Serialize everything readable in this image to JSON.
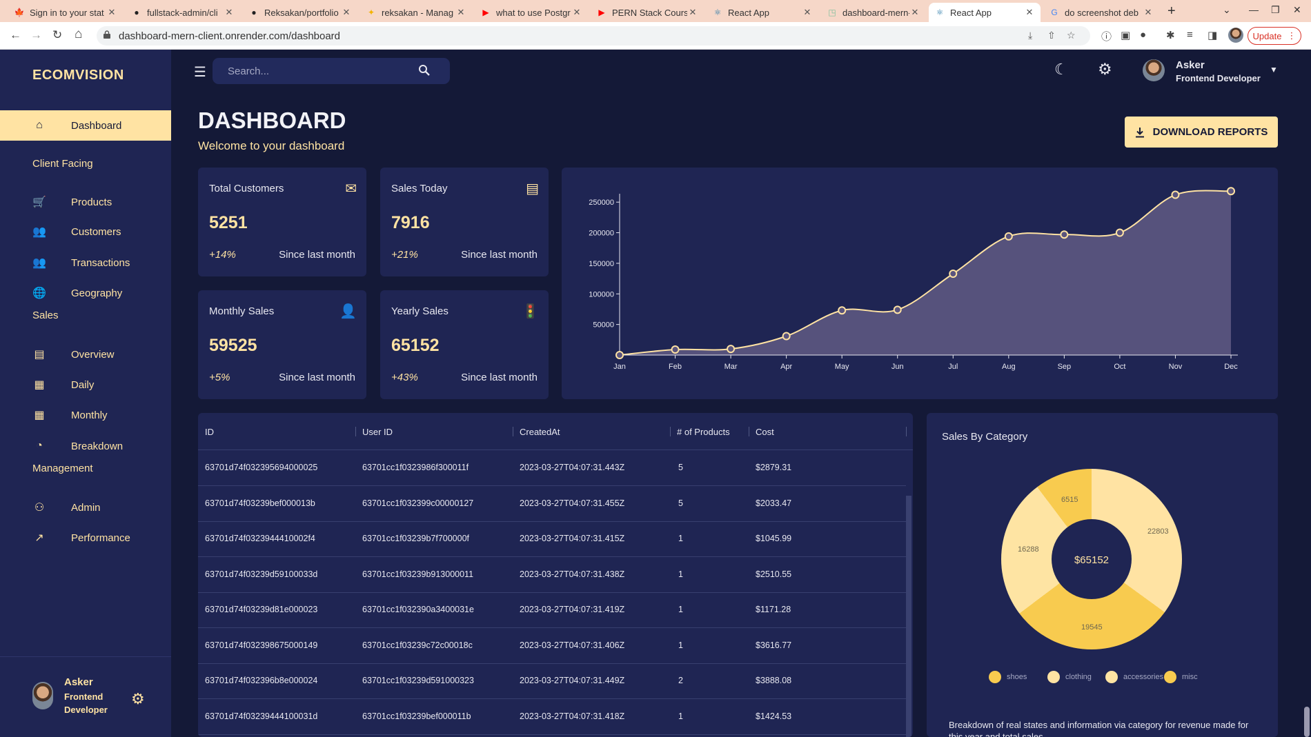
{
  "browser": {
    "tabs": [
      {
        "title": "Sign in to your stat",
        "icon": "maple-leaf-icon"
      },
      {
        "title": "fullstack-admin/cli",
        "icon": "github-icon"
      },
      {
        "title": "Reksakan/portfolio",
        "icon": "github-icon"
      },
      {
        "title": "reksakan - Manag",
        "icon": "flame-icon"
      },
      {
        "title": "what to use Postgr",
        "icon": "youtube-icon"
      },
      {
        "title": "PERN Stack Course",
        "icon": "youtube-icon"
      },
      {
        "title": "React App",
        "icon": "react-icon"
      },
      {
        "title": "dashboard-mern-c",
        "icon": "render-icon"
      },
      {
        "title": "React App",
        "icon": "react-icon",
        "active": true
      },
      {
        "title": "do screenshot deb",
        "icon": "google-icon"
      }
    ],
    "url": "dashboard-mern-client.onrender.com/dashboard",
    "update_label": "Update"
  },
  "sidebar": {
    "brand": "ECOMVISION",
    "items": [
      {
        "label": "Dashboard",
        "icon": "home-icon",
        "active": true
      },
      {
        "section": "Client Facing"
      },
      {
        "label": "Products",
        "icon": "cart-icon"
      },
      {
        "label": "Customers",
        "icon": "groups-icon"
      },
      {
        "label": "Transactions",
        "icon": "receipt-icon"
      },
      {
        "label": "Geography",
        "icon": "globe-icon"
      },
      {
        "section": "Sales"
      },
      {
        "label": "Overview",
        "icon": "point-of-sale-icon"
      },
      {
        "label": "Daily",
        "icon": "calendar-today-icon"
      },
      {
        "label": "Monthly",
        "icon": "calendar-month-icon"
      },
      {
        "label": "Breakdown",
        "icon": "pie-chart-icon"
      },
      {
        "section": "Management"
      },
      {
        "label": "Admin",
        "icon": "admin-icon"
      },
      {
        "label": "Performance",
        "icon": "trending-up-icon"
      }
    ],
    "user": {
      "name": "Asker",
      "role": "Frontend Developer"
    }
  },
  "topbar": {
    "search_placeholder": "Search...",
    "user": {
      "name": "Asker",
      "role": "Frontend Developer"
    }
  },
  "header": {
    "title": "DASHBOARD",
    "subtitle": "Welcome to your dashboard",
    "download_label": "DOWNLOAD REPORTS"
  },
  "stats": [
    {
      "title": "Total Customers",
      "value": "5251",
      "increase": "+14%",
      "description": "Since last month",
      "icon": "email-icon"
    },
    {
      "title": "Sales Today",
      "value": "7916",
      "increase": "+21%",
      "description": "Since last month",
      "icon": "point-of-sale-icon"
    },
    {
      "title": "Monthly Sales",
      "value": "59525",
      "increase": "+5%",
      "description": "Since last month",
      "icon": "person-add-icon"
    },
    {
      "title": "Yearly Sales",
      "value": "65152",
      "increase": "+43%",
      "description": "Since last month",
      "icon": "traffic-icon"
    }
  ],
  "chart_data": [
    {
      "type": "area",
      "x": [
        "Jan",
        "Feb",
        "Mar",
        "Apr",
        "May",
        "Jun",
        "Jul",
        "Aug",
        "Sep",
        "Oct",
        "Nov",
        "Dec"
      ],
      "series": [
        {
          "values": [
            0,
            9000,
            10000,
            31000,
            73000,
            74000,
            133000,
            194000,
            197000,
            200000,
            262000,
            268000
          ]
        }
      ],
      "yticks": [
        50000,
        100000,
        150000,
        200000,
        250000
      ],
      "ylim": [
        0,
        275000
      ],
      "colors": {
        "line": "#ffe3a3",
        "fill": "#5a547e"
      },
      "grid": false
    },
    {
      "type": "pie",
      "title": "Sales By Category",
      "categories": [
        "shoes",
        "clothing",
        "accessories",
        "misc"
      ],
      "values": [
        22803,
        19545,
        16288,
        6515
      ],
      "total": "$65152",
      "colors": [
        "#ffe3a3",
        "#f8cb4f",
        "#fee4a3",
        "#f8cb4f"
      ],
      "description": "Breakdown of real states and information via category for revenue made for this year and total sales."
    }
  ],
  "transactions": {
    "columns": [
      "ID",
      "User ID",
      "CreatedAt",
      "# of Products",
      "Cost"
    ],
    "rows": [
      [
        "63701d74f032395694000025",
        "63701cc1f0323986f300011f",
        "2023-03-27T04:07:31.443Z",
        "5",
        "$2879.31"
      ],
      [
        "63701d74f03239bef000013b",
        "63701cc1f032399c00000127",
        "2023-03-27T04:07:31.455Z",
        "5",
        "$2033.47"
      ],
      [
        "63701d74f0323944410002f4",
        "63701cc1f03239b7f700000f",
        "2023-03-27T04:07:31.415Z",
        "1",
        "$1045.99"
      ],
      [
        "63701d74f03239d59100033d",
        "63701cc1f03239b913000011",
        "2023-03-27T04:07:31.438Z",
        "1",
        "$2510.55"
      ],
      [
        "63701d74f03239d81e000023",
        "63701cc1f032390a3400031e",
        "2023-03-27T04:07:31.419Z",
        "1",
        "$1171.28"
      ],
      [
        "63701d74f032398675000149",
        "63701cc1f03239c72c00018c",
        "2023-03-27T04:07:31.406Z",
        "1",
        "$3616.77"
      ],
      [
        "63701d74f032396b8e000024",
        "63701cc1f03239d591000323",
        "2023-03-27T04:07:31.449Z",
        "2",
        "$3888.08"
      ],
      [
        "63701d74f03239444100031d",
        "63701cc1f03239bef000011b",
        "2023-03-27T04:07:31.418Z",
        "1",
        "$1424.53"
      ]
    ]
  }
}
